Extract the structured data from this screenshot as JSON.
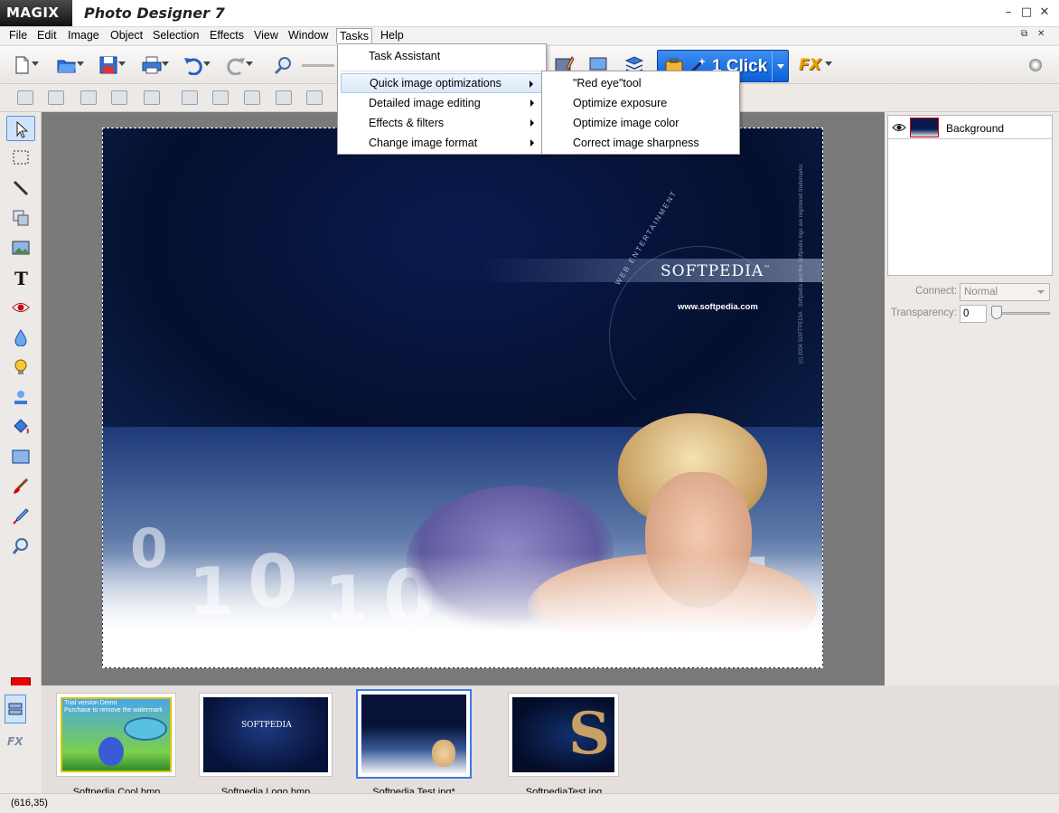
{
  "window": {
    "brand": "MAGIX",
    "title": "Photo Designer 7",
    "controls": {
      "minimize": "–",
      "maximize": "□",
      "close": "✕"
    },
    "mdi_controls": {
      "restore": "⧉",
      "close": "✕"
    }
  },
  "menubar": {
    "items": [
      "File",
      "Edit",
      "Image",
      "Object",
      "Selection",
      "Effects",
      "View",
      "Window",
      "Tasks",
      "Help"
    ],
    "active": "Tasks"
  },
  "tasks_menu": {
    "items": [
      {
        "label": "Task Assistant",
        "has_submenu": false
      },
      {
        "label": "Quick image optimizations",
        "has_submenu": true,
        "highlighted": true
      },
      {
        "label": "Detailed image editing",
        "has_submenu": true
      },
      {
        "label": "Effects & filters",
        "has_submenu": true
      },
      {
        "label": "Change image format",
        "has_submenu": true
      }
    ]
  },
  "quick_optimizations_submenu": {
    "items": [
      "\"Red eye\"tool",
      "Optimize exposure",
      "Optimize image color",
      "Correct image sharpness"
    ]
  },
  "toolbar": {
    "one_click_label": "1 Click",
    "fx_label": "FX"
  },
  "image_content": {
    "brand": "SOFTPEDIA",
    "tm": "™",
    "url": "www.softpedia.com",
    "arc_text": "WEB ENTERTAINMENT",
    "vertical_text": "(c) 2004 SOFTPEDIA · Softpedia and the Softpedia logo are registered trademarks"
  },
  "layers": {
    "items": [
      {
        "name": "Background",
        "visible": true
      }
    ]
  },
  "layer_properties": {
    "connect_label": "Connect:",
    "connect_value": "Normal",
    "transparency_label": "Transparency:",
    "transparency_value": "0"
  },
  "filmstrip": {
    "items": [
      {
        "label": "Softpedia Cool.bmp",
        "selected": false,
        "caption": "Trial version Demo\nPurchase to remove the watermark"
      },
      {
        "label": "Softpedia Logo.bmp",
        "selected": false,
        "caption": "SOFTPEDIA"
      },
      {
        "label": "Softpedia Test.jpg*",
        "selected": true
      },
      {
        "label": "SoftpediaTest.jpg",
        "selected": false
      }
    ]
  },
  "status": {
    "coordinates": "(616,35)"
  },
  "colors": {
    "accent": "#0a5fd8",
    "foreground_color": "#ee0000",
    "selection_blue": "#3a7ae8"
  }
}
